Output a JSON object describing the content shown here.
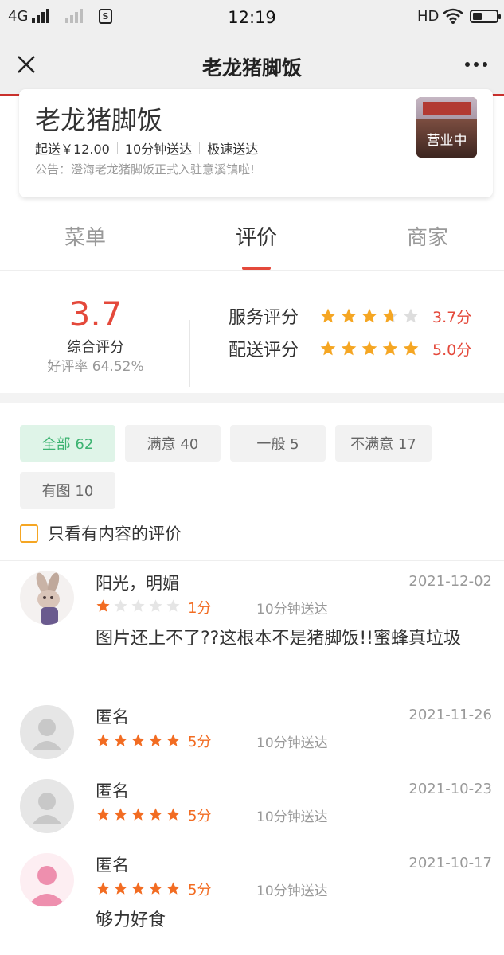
{
  "status_bar": {
    "carrier": "4G",
    "time": "12:19",
    "hd": "HD",
    "icons": [
      "signal-icon",
      "sim-icon",
      "wifi-icon",
      "battery-icon"
    ]
  },
  "nav": {
    "title": "老龙猪脚饭",
    "close_icon": "close-icon",
    "more_icon": "more-icon"
  },
  "shop": {
    "name": "老龙猪脚饭",
    "min_order": "起送￥12.00",
    "delivery_time": "10分钟送达",
    "delivery_type": "极速送达",
    "notice": "公告：澄海老龙猪脚饭正式入驻意溪镇啦!",
    "status": "营业中"
  },
  "tabs": [
    {
      "label": "菜单",
      "active": false
    },
    {
      "label": "评价",
      "active": true
    },
    {
      "label": "商家",
      "active": false
    }
  ],
  "scores": {
    "overall": "3.7",
    "overall_label": "综合评分",
    "positive_rate": "好评率 64.52%",
    "service": {
      "label": "服务评分",
      "value": "3.7分",
      "rating": 3.7
    },
    "delivery": {
      "label": "配送评分",
      "value": "5.0分",
      "rating": 5.0
    }
  },
  "filters": [
    {
      "label": "全部 62",
      "active": true
    },
    {
      "label": "满意 40",
      "active": false
    },
    {
      "label": "一般 5",
      "active": false
    },
    {
      "label": "不满意 17",
      "active": false
    },
    {
      "label": "有图 10",
      "active": false
    }
  ],
  "only_content_label": "只看有内容的评价",
  "colors": {
    "accent_red": "#e4493b",
    "star_orange": "#f5a623",
    "review_star": "#f26c22",
    "chip_active_bg": "#dff4e8",
    "chip_active_text": "#3cb371"
  },
  "reviews": [
    {
      "name": "阳光，明媚",
      "date": "2021-12-02",
      "rating": 1,
      "score": "1分",
      "delivery": "10分钟送达",
      "text": "图片还上不了??这根本不是猪脚饭!!蜜蜂真垃圾",
      "avatar": "anime-avatar"
    },
    {
      "name": "匿名",
      "date": "2021-11-26",
      "rating": 5,
      "score": "5分",
      "delivery": "10分钟送达",
      "text": "",
      "avatar": "default-avatar"
    },
    {
      "name": "匿名",
      "date": "2021-10-23",
      "rating": 5,
      "score": "5分",
      "delivery": "10分钟送达",
      "text": "",
      "avatar": "default-avatar"
    },
    {
      "name": "匿名",
      "date": "2021-10-17",
      "rating": 5,
      "score": "5分",
      "delivery": "10分钟送达",
      "text": "够力好食",
      "avatar": "pink-avatar"
    }
  ]
}
